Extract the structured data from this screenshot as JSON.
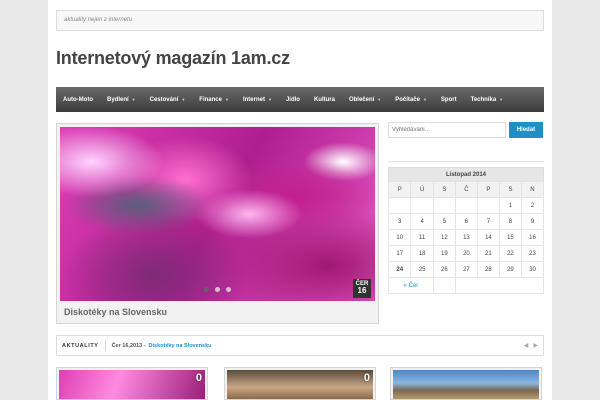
{
  "header": {
    "tagline": "aktuality nejen z internetu",
    "site_title": "Internetový magazín 1am.cz"
  },
  "nav": {
    "items": [
      {
        "label": "Auto-Moto",
        "dropdown": false
      },
      {
        "label": "Bydlení",
        "dropdown": true
      },
      {
        "label": "Cestování",
        "dropdown": true
      },
      {
        "label": "Finance",
        "dropdown": true
      },
      {
        "label": "Internet",
        "dropdown": true
      },
      {
        "label": "Jídlo",
        "dropdown": false
      },
      {
        "label": "Kultura",
        "dropdown": false
      },
      {
        "label": "Oblečení",
        "dropdown": true
      },
      {
        "label": "Počítače",
        "dropdown": true
      },
      {
        "label": "Sport",
        "dropdown": false
      },
      {
        "label": "Technika",
        "dropdown": true
      }
    ],
    "caret_glyph": "▼"
  },
  "slider": {
    "caption": "Diskotéky na Slovensku",
    "badge_month": "ČER",
    "badge_day": "16",
    "slide_count": 3,
    "active_index": 0
  },
  "search": {
    "placeholder": "Vyhledávání...",
    "button_label": "Hledat"
  },
  "calendar": {
    "caption": "Listopad 2014",
    "weekdays": [
      "P",
      "Ú",
      "S",
      "Č",
      "P",
      "S",
      "N"
    ],
    "weeks": [
      [
        "",
        "",
        "",
        "",
        "",
        "1",
        "2"
      ],
      [
        "3",
        "4",
        "5",
        "6",
        "7",
        "8",
        "9"
      ],
      [
        "10",
        "11",
        "12",
        "13",
        "14",
        "15",
        "16"
      ],
      [
        "17",
        "18",
        "19",
        "20",
        "21",
        "22",
        "23"
      ],
      [
        "24",
        "25",
        "26",
        "27",
        "28",
        "29",
        "30"
      ]
    ],
    "today": "24",
    "prev_link": "« Čer"
  },
  "news_ticker": {
    "label": "AKTUALITY",
    "date": "Čer 16,2013 -",
    "link": "Diskotéky na Slovensku",
    "prev_arrow": "◀",
    "next_arrow": "▶"
  },
  "thumbnails": [
    {
      "count": "0"
    },
    {
      "count": "0"
    },
    {
      "count": ""
    }
  ],
  "colors": {
    "accent": "#1e90c8",
    "nav_dark": "#3c3c3c"
  }
}
